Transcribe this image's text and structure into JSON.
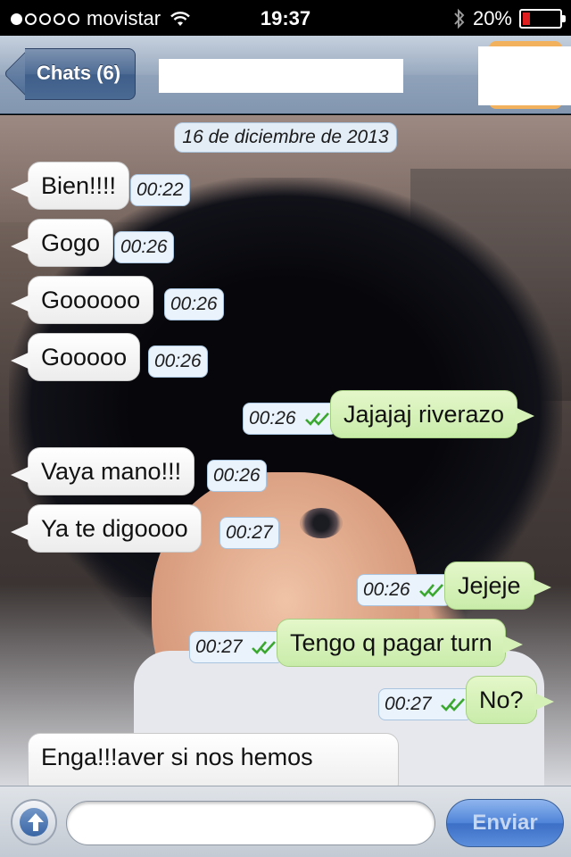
{
  "status_bar": {
    "carrier": "movistar",
    "time": "19:37",
    "battery": "20%",
    "battery_level": 0.2,
    "signal_bars_filled": 1,
    "signal_bars_total": 5
  },
  "nav": {
    "back_label": "Chats (6)"
  },
  "chat": {
    "date": "16 de diciembre de 2013",
    "messages": [
      {
        "direction": "in",
        "text": "Bien!!!!",
        "time": "00:22"
      },
      {
        "direction": "in",
        "text": "Gogo",
        "time": "00:26"
      },
      {
        "direction": "in",
        "text": "Goooooo",
        "time": "00:26"
      },
      {
        "direction": "in",
        "text": "Gooooo",
        "time": "00:26"
      },
      {
        "direction": "out",
        "text": "Jajajaj riverazo",
        "time": "00:26",
        "read": true
      },
      {
        "direction": "in",
        "text": "Vaya mano!!!",
        "time": "00:26"
      },
      {
        "direction": "in",
        "text": "Ya te digoooo",
        "time": "00:27"
      },
      {
        "direction": "out",
        "text": "Jejeje",
        "time": "00:26",
        "read": true
      },
      {
        "direction": "out",
        "text": "Tengo q pagar turn",
        "time": "00:27",
        "read": true
      },
      {
        "direction": "out",
        "text": "No?",
        "time": "00:27",
        "read": true
      },
      {
        "direction": "in",
        "text": "Enga!!!aver si nos hemos",
        "time": ""
      }
    ]
  },
  "input_bar": {
    "placeholder": "",
    "send_label": "Enviar"
  },
  "colors": {
    "incoming_bubble": "#ffffff",
    "outgoing_bubble": "#d6f1b8",
    "tick_green": "#3aa82f",
    "nav_blue": "#4d6b94"
  }
}
